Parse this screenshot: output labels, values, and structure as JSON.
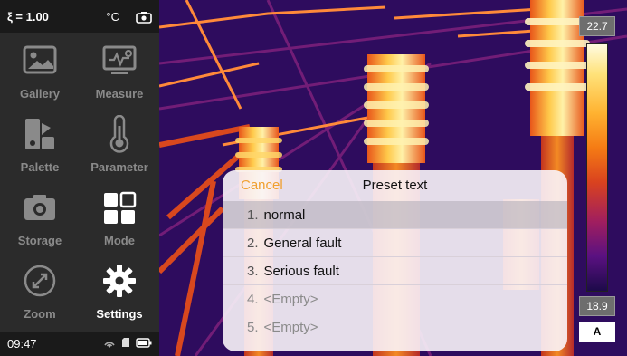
{
  "status_top": {
    "emissivity": "ξ = 1.00",
    "unit": "°C"
  },
  "menu": [
    {
      "label": "Gallery",
      "icon": "gallery-icon"
    },
    {
      "label": "Measure",
      "icon": "measure-icon"
    },
    {
      "label": "Palette",
      "icon": "palette-icon"
    },
    {
      "label": "Parameter",
      "icon": "thermometer-icon"
    },
    {
      "label": "Storage",
      "icon": "camera-icon"
    },
    {
      "label": "Mode",
      "icon": "mode-grid-icon"
    },
    {
      "label": "Zoom",
      "icon": "zoom-icon"
    },
    {
      "label": "Settings",
      "icon": "settings-gear-icon",
      "active": true
    }
  ],
  "status_bottom": {
    "time": "09:47"
  },
  "scale": {
    "max": "22.7",
    "min": "18.9",
    "mode": "A"
  },
  "dialog": {
    "cancel_label": "Cancel",
    "title": "Preset text",
    "items": [
      {
        "num": "1.",
        "text": "normal",
        "selected": true
      },
      {
        "num": "2.",
        "text": "General fault"
      },
      {
        "num": "3.",
        "text": "Serious fault"
      },
      {
        "num": "4.",
        "text": "<Empty>",
        "empty": true
      },
      {
        "num": "5.",
        "text": "<Empty>",
        "empty": true
      }
    ]
  },
  "colors": {
    "accent": "#f0a030",
    "sidebar_bg": "#2b2b2b",
    "sidebar_text": "#8a8a8a"
  }
}
